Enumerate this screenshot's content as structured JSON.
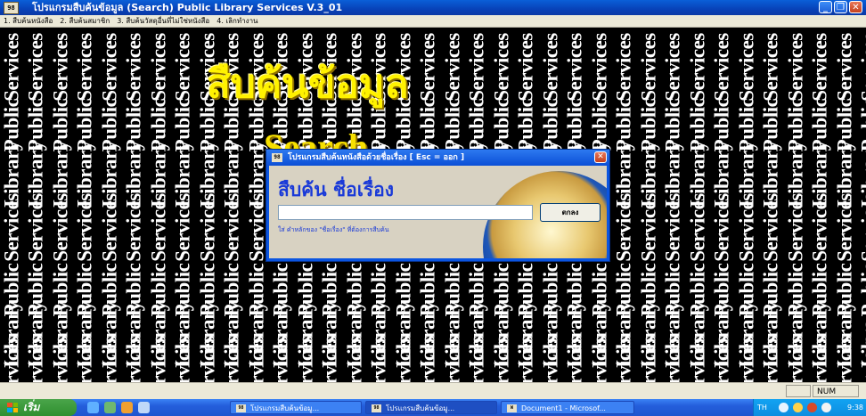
{
  "window": {
    "app_icon": "98",
    "title": "โปรแกรมสืบค้นข้อมูล (Search)  Public Library Services V.3_01",
    "buttons": {
      "minimize": "_",
      "maximize": "❐",
      "close": "✕"
    }
  },
  "menu": [
    "1. สืบค้นหนังสือ",
    "2. สืบค้นสมาชิก",
    "3. สืบค้นวัสดุอื่นที่ไม่ใช่หนังสือ",
    "4. เลิกทำงาน"
  ],
  "background": {
    "word_public": "Public",
    "word_library": "Library",
    "word_services": "Services",
    "heading_thai": "สืบค้นข้อมูล",
    "heading_en": "Search"
  },
  "dialog": {
    "icon": "98",
    "title": "โปรแกรมสืบค้นหนังสือด้วยชื่อเรื่อง    [ Esc = ออก ]",
    "heading": "สืบค้น ชื่อเรื่อง",
    "input_value": "",
    "ok_label": "ตกลง",
    "hint": "ใส่ คำหลักของ \"ชื่อเรื่อง\" ที่ต้องการสืบค้น"
  },
  "statusbar": {
    "num": "NUM"
  },
  "taskbar": {
    "start_label": "เริ่ม",
    "tasks": [
      {
        "icon": "98",
        "label": "โปรแกรมสืบค้นข้อมู..."
      },
      {
        "icon": "98",
        "label": "โปรแกรมสืบค้นข้อมู..."
      },
      {
        "icon": "W",
        "label": "Document1 - Microsof..."
      }
    ],
    "tray": {
      "lang": "TH",
      "clock": "9:38"
    }
  },
  "colors": {
    "accent_yellow": "#fff200",
    "dialog_blue": "#0b55e0",
    "text_blue": "#1a3ad8"
  }
}
